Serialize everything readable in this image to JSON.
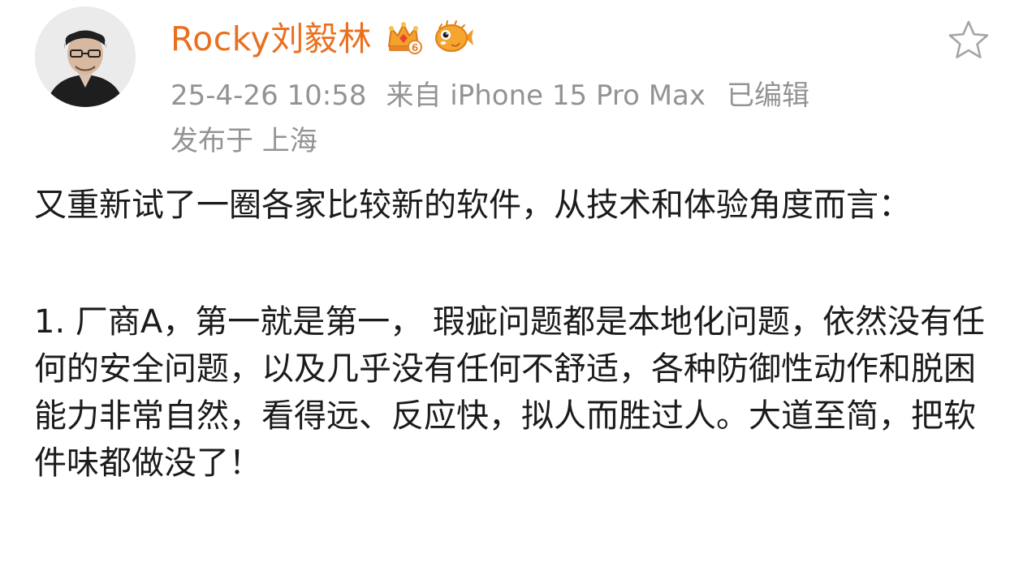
{
  "user": {
    "name": "Rocky刘毅林",
    "vip_badge_icon": "crown-vip-badge-icon",
    "fish_badge_icon": "pufferfish-badge-icon",
    "accent_color": "#ea6f1e"
  },
  "meta": {
    "timestamp": "25-4-26 10:58",
    "source": "来自 iPhone 15 Pro Max",
    "edited": "已编辑",
    "location": "发布于 上海"
  },
  "actions": {
    "favorite_icon": "star-outline-icon"
  },
  "post": {
    "intro": "又重新试了一圈各家比较新的软件，从技术和体验角度而言：",
    "item1": "1. 厂商A，第一就是第一， 瑕疵问题都是本地化问题，依然没有任何的安全问题，以及几乎没有任何不舒适，各种防御性动作和脱困能力非常自然，看得远、反应快，拟人而胜过人。大道至简，把软件味都做没了！"
  }
}
